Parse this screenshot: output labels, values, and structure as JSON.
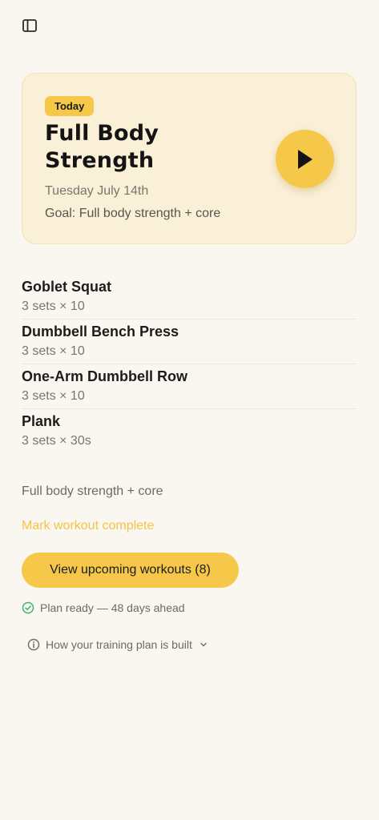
{
  "card": {
    "badge": "Today",
    "title": "Full Body Strength",
    "date": "Tuesday July 14th",
    "goal": "Goal: Full body strength + core"
  },
  "exercises": [
    {
      "name": "Goblet Squat",
      "detail": "3 sets × 10"
    },
    {
      "name": "Dumbbell Bench Press",
      "detail": "3 sets × 10"
    },
    {
      "name": "One-Arm Dumbbell Row",
      "detail": "3 sets × 10"
    },
    {
      "name": "Plank",
      "detail": "3 sets × 30s"
    }
  ],
  "summary": "Full body strength + core",
  "mark_complete": "Mark workout complete",
  "upcoming_button": "View upcoming workouts (8)",
  "status": "Plan ready — 48 days ahead",
  "info": "How your training plan is built",
  "colors": {
    "accent": "#f5c84a",
    "card_bg": "#faf0d8",
    "page_bg": "#f9f7f0",
    "success": "#3cb371"
  },
  "icons": {
    "sidebar": "sidebar-toggle-icon",
    "play": "play-icon",
    "status": "check-circle-icon",
    "info": "info-circle-icon",
    "chevron": "chevron-down-icon"
  }
}
